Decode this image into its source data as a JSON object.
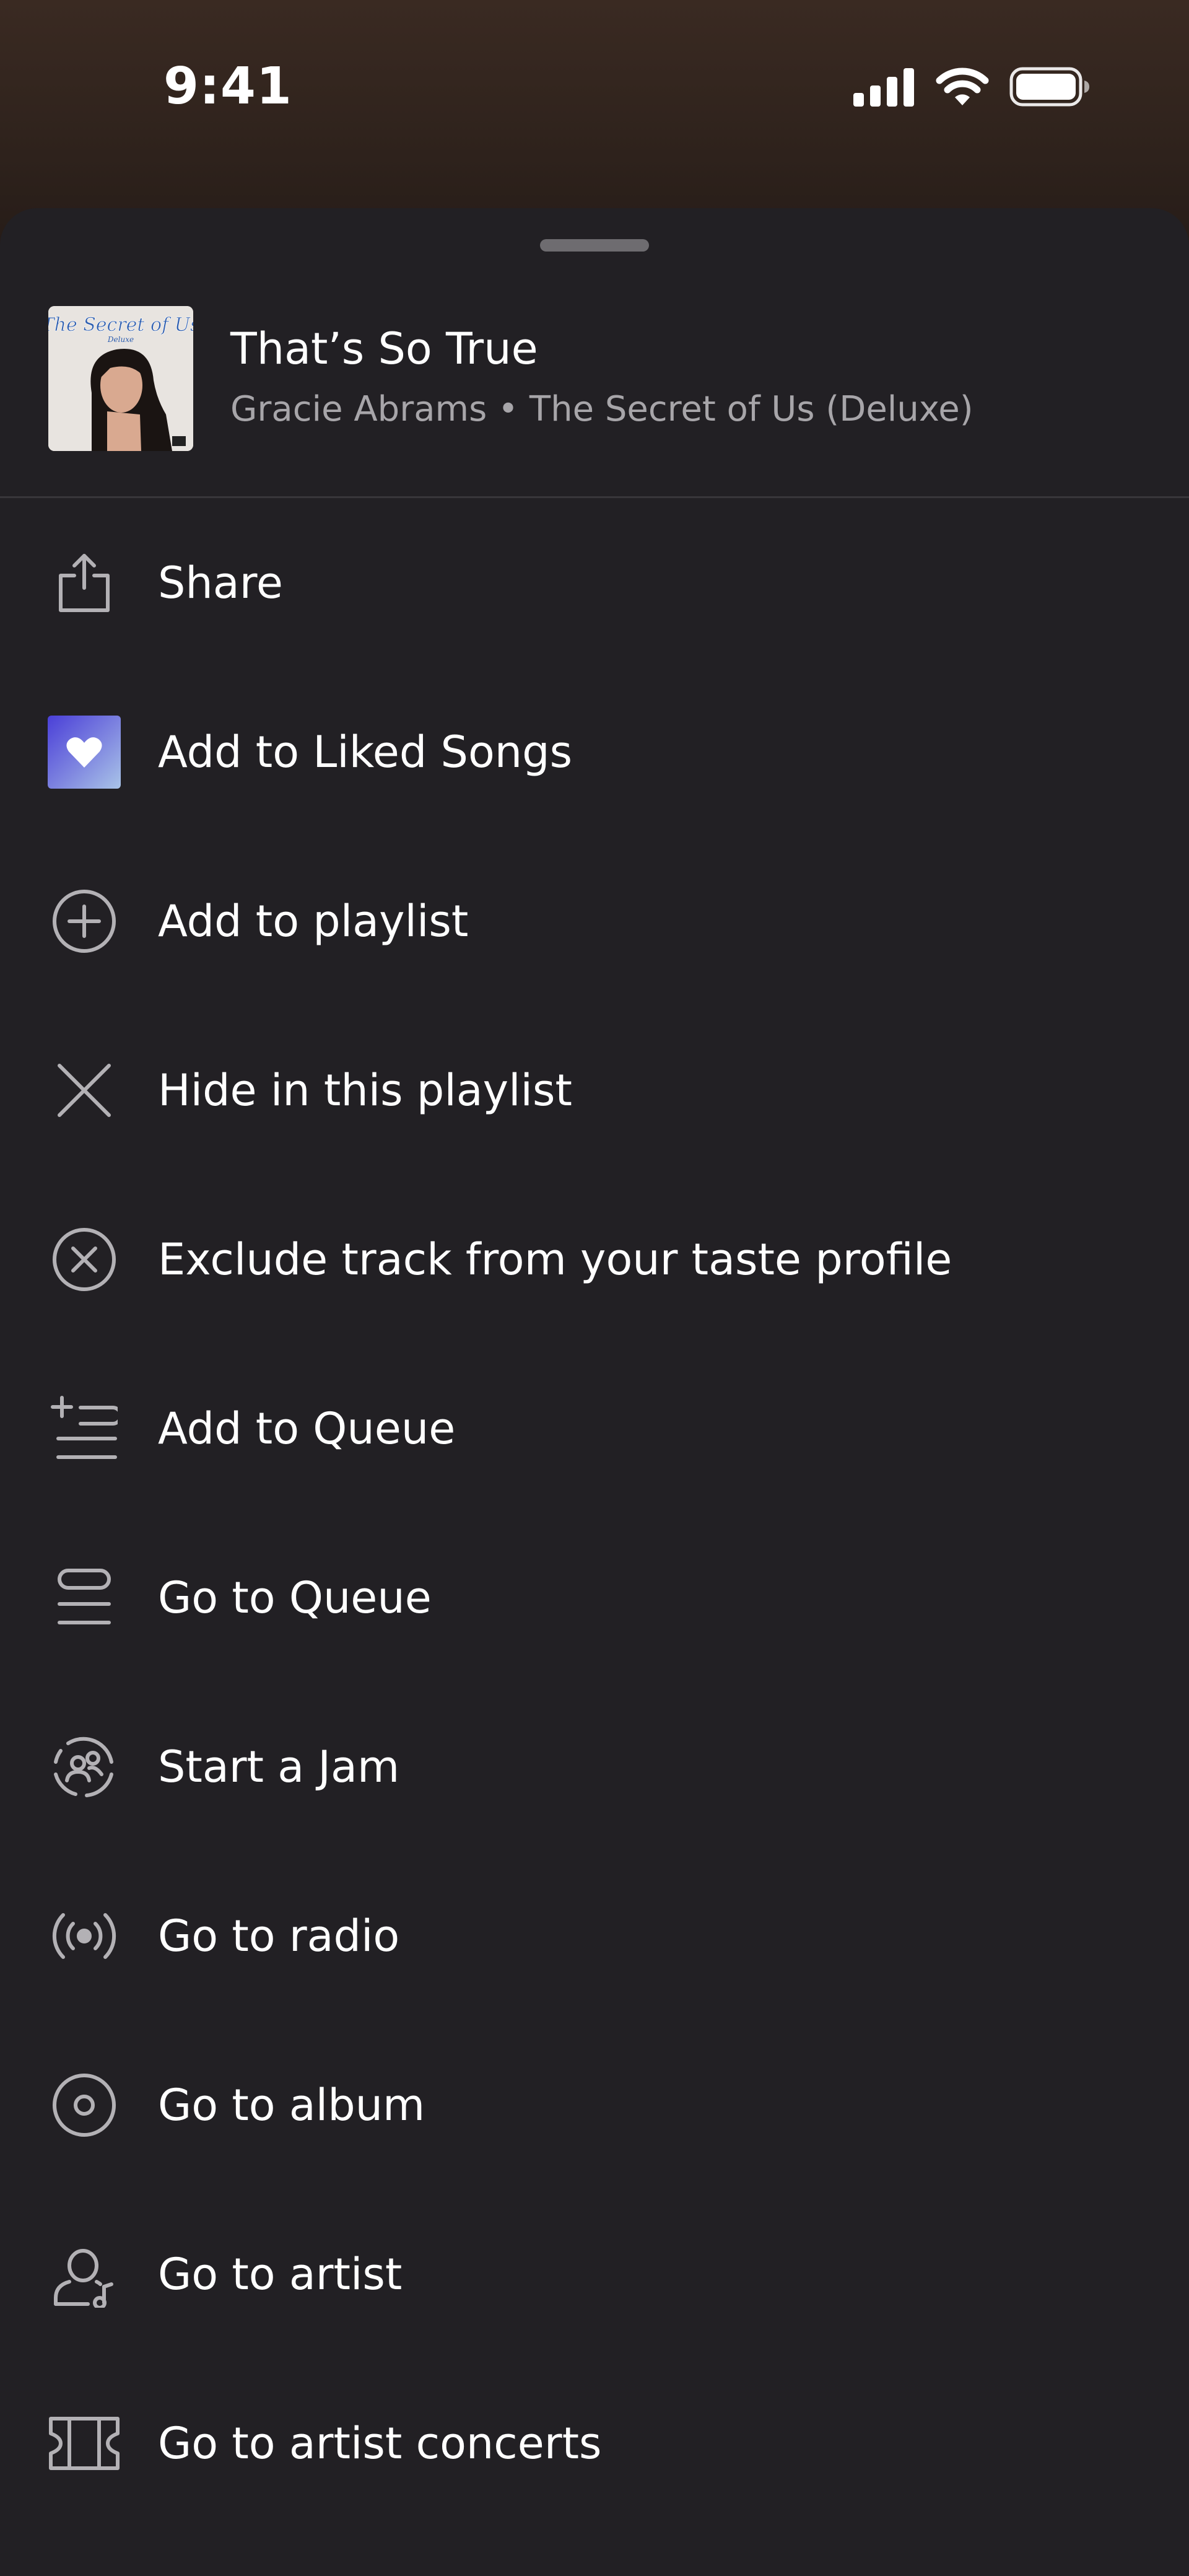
{
  "status_bar": {
    "time": "9:41",
    "icons": [
      "cellular-signal-icon",
      "wifi-icon",
      "battery-icon"
    ]
  },
  "track": {
    "title": "That’s So True",
    "subtitle": "Gracie Abrams • The Secret of Us (Deluxe)",
    "album_art_text": "The Secret of Us",
    "album_art_subtext": "Deluxe"
  },
  "colors": {
    "sheet_background": "#222024",
    "text_primary": "#ffffff",
    "text_secondary": "#a7a5a9",
    "icon": "#b3b1b5",
    "liked_gradient_start": "#4a3fd8",
    "liked_gradient_end": "#a9c4e8"
  },
  "menu": {
    "items": [
      {
        "label": "Share",
        "icon": "share-icon"
      },
      {
        "label": "Add to Liked Songs",
        "icon": "liked-songs-icon"
      },
      {
        "label": "Add to playlist",
        "icon": "plus-circle-icon"
      },
      {
        "label": "Hide in this playlist",
        "icon": "x-icon"
      },
      {
        "label": "Exclude track from your taste profile",
        "icon": "x-circle-icon"
      },
      {
        "label": "Add to Queue",
        "icon": "add-to-queue-icon"
      },
      {
        "label": "Go to Queue",
        "icon": "queue-icon"
      },
      {
        "label": "Start a Jam",
        "icon": "jam-icon"
      },
      {
        "label": "Go to radio",
        "icon": "radio-icon"
      },
      {
        "label": "Go to album",
        "icon": "album-icon"
      },
      {
        "label": "Go to artist",
        "icon": "artist-icon"
      },
      {
        "label": "Go to artist concerts",
        "icon": "ticket-icon"
      }
    ]
  }
}
